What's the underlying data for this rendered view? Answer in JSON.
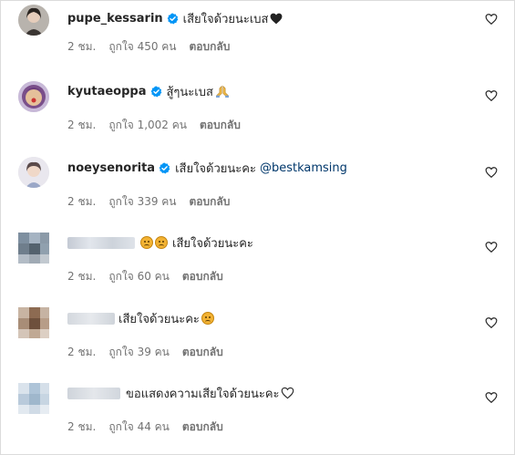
{
  "comments": [
    {
      "username": "pupe_kessarin",
      "verified": true,
      "text": "เสียใจด้วยนะเบส",
      "emoji": "black-heart",
      "time": "2 ชม.",
      "likes": "ถูกใจ 450 คน",
      "reply": "ตอบกลับ"
    },
    {
      "username": "kyutaeoppa",
      "verified": true,
      "text": "สู้ๆนะเบส",
      "emoji": "folded-hands",
      "time": "2 ชม.",
      "likes": "ถูกใจ 1,002 คน",
      "reply": "ตอบกลับ"
    },
    {
      "username": "noeysenorita",
      "verified": true,
      "text": "เสียใจด้วยนะคะ",
      "mention": "@bestkamsing",
      "time": "2 ชม.",
      "likes": "ถูกใจ 339 คน",
      "reply": "ตอบกลับ"
    },
    {
      "username_blurred": true,
      "text": "เสียใจด้วยนะคะ",
      "emoji": "sad-face x2 (before text)",
      "time": "2 ชม.",
      "likes": "ถูกใจ 60 คน",
      "reply": "ตอบกลับ"
    },
    {
      "username_blurred": true,
      "text": "เสียใจด้วยนะคะ",
      "emoji": "sad-face (after text)",
      "time": "2 ชม.",
      "likes": "ถูกใจ 39 คน",
      "reply": "ตอบกลับ"
    },
    {
      "username_blurred": true,
      "text": "ขอแสดงความเสียใจด้วยนะคะ",
      "emoji": "white-heart",
      "time": "2 ชม.",
      "likes": "ถูกใจ 44 คน",
      "reply": "ตอบกลับ"
    }
  ],
  "icons": {
    "like": "heart-outline-icon",
    "verified": "verified-badge-icon"
  },
  "colors": {
    "verified": "#0095f6",
    "mention": "#00376b",
    "meta": "#737373",
    "text": "#262626"
  }
}
